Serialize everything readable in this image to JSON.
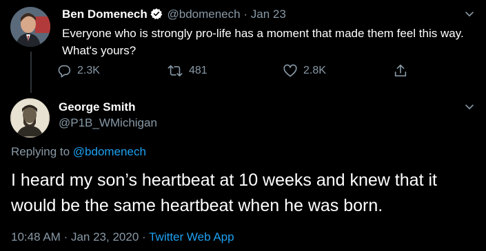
{
  "parent_tweet": {
    "author_name": "Ben Domenech",
    "author_handle": "@bdomenech",
    "separator": "·",
    "date": "Jan 23",
    "text": "Everyone who is strongly pro-life has a moment that made them feel this way. What's yours?",
    "replies": "2.3K",
    "retweets": "481",
    "likes": "2.8K",
    "verified": true
  },
  "main_tweet": {
    "author_name": "George Smith",
    "author_handle": "@P1B_WMichigan",
    "replying_prefix": "Replying to",
    "replying_to": "@bdomenech",
    "text": "I heard my son’s heartbeat at 10 weeks and knew that it would be the same heartbeat when he was born.",
    "time": "10:48 AM",
    "separator": "·",
    "date": "Jan 23, 2020",
    "source": "Twitter Web App"
  },
  "icons": {
    "reply": "reply-icon",
    "retweet": "retweet-icon",
    "like": "heart-icon",
    "share": "share-icon",
    "more": "chevron-down-icon",
    "verified": "verified-badge-icon"
  },
  "colors": {
    "background": "#000000",
    "text": "#ffffff",
    "muted": "#8899a6",
    "link": "#1da1f2",
    "thread_line": "#2f3336"
  }
}
